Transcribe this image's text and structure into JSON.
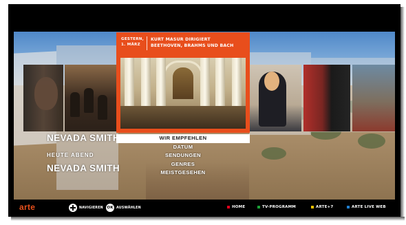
{
  "featured": {
    "date_line1": "GESTERN,",
    "date_line2": "1. MÄRZ",
    "title_line1": "KURT MASUR DIRIGIERT",
    "title_line2": "BEETHOVEN, BRAHMS UND BACH"
  },
  "left": {
    "title_1": "NEVADA SMITH",
    "section_label": "HEUTE ABEND",
    "title_2": "NEVADA SMITH"
  },
  "menu": {
    "items": [
      {
        "label": "WIR EMPFEHLEN",
        "selected": true
      },
      {
        "label": "DATUM",
        "selected": false
      },
      {
        "label": "SENDUNGEN",
        "selected": false
      },
      {
        "label": "GENRES",
        "selected": false
      },
      {
        "label": "MEISTGESEHEN",
        "selected": false
      }
    ]
  },
  "bottom_bar": {
    "logo": "arte",
    "navigate_label": "NAVIGIEREN",
    "ok_icon_label": "OK",
    "select_label": "AUSWÄHLEN",
    "buttons": [
      {
        "label": "HOME",
        "color": "#e3001b"
      },
      {
        "label": "TV-PROGRAMM",
        "color": "#1aa037"
      },
      {
        "label": "ARTE+7",
        "color": "#f2c200"
      },
      {
        "label": "ARTE LIVE WEB",
        "color": "#1f7fd0"
      }
    ]
  },
  "colors": {
    "accent": "#e84e1c",
    "background": "#000000"
  }
}
